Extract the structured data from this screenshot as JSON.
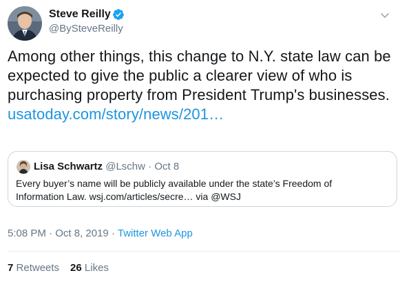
{
  "author": {
    "name": "Steve Reilly",
    "handle": "@BySteveReilly",
    "verified": true
  },
  "tweet": {
    "text_lines": [
      "Among other things, this change to N.Y. state law can be",
      "expected to give the public a clearer view of who is",
      "purchasing property from President Trump's businesses."
    ],
    "link": "usatoday.com/story/news/201…"
  },
  "quoted": {
    "name": "Lisa Schwartz",
    "handle": "@Lschw",
    "separator": "·",
    "date": "Oct 8",
    "text_lines": [
      "Every buyer’s name will be publicly available under the state’s Freedom of",
      "Information Law. wsj.com/articles/secre… via @WSJ"
    ]
  },
  "meta": {
    "time": "5:08 PM",
    "separator": "·",
    "date": "Oct 8, 2019",
    "source": "Twitter Web App"
  },
  "stats": {
    "retweets_count": "7",
    "retweets_label": "Retweets",
    "likes_count": "26",
    "likes_label": "Likes"
  },
  "icons": {
    "verified": "verified-badge-icon",
    "caret": "chevron-down-icon"
  },
  "colors": {
    "link": "#1b95e0",
    "secondary_text": "#657786",
    "primary_text": "#14171a",
    "border": "#ccd6dd"
  }
}
